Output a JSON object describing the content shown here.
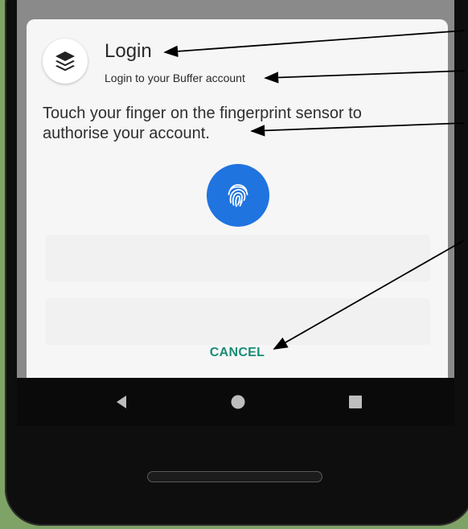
{
  "dialog": {
    "title": "Login",
    "subtitle": "Login to your Buffer account",
    "description": "Touch your finger on the fingerprint sensor to authorise your account.",
    "cancel_label": "CANCEL"
  },
  "icons": {
    "app": "buffer-layers-icon",
    "fingerprint": "fingerprint-icon",
    "nav_back": "back-triangle-icon",
    "nav_home": "home-circle-icon",
    "nav_recents": "recents-square-icon"
  },
  "colors": {
    "background": "#7fa266",
    "accent_blue": "#1f74e0",
    "cancel_teal": "#1a8c77",
    "dialog_bg": "#f6f6f6"
  }
}
